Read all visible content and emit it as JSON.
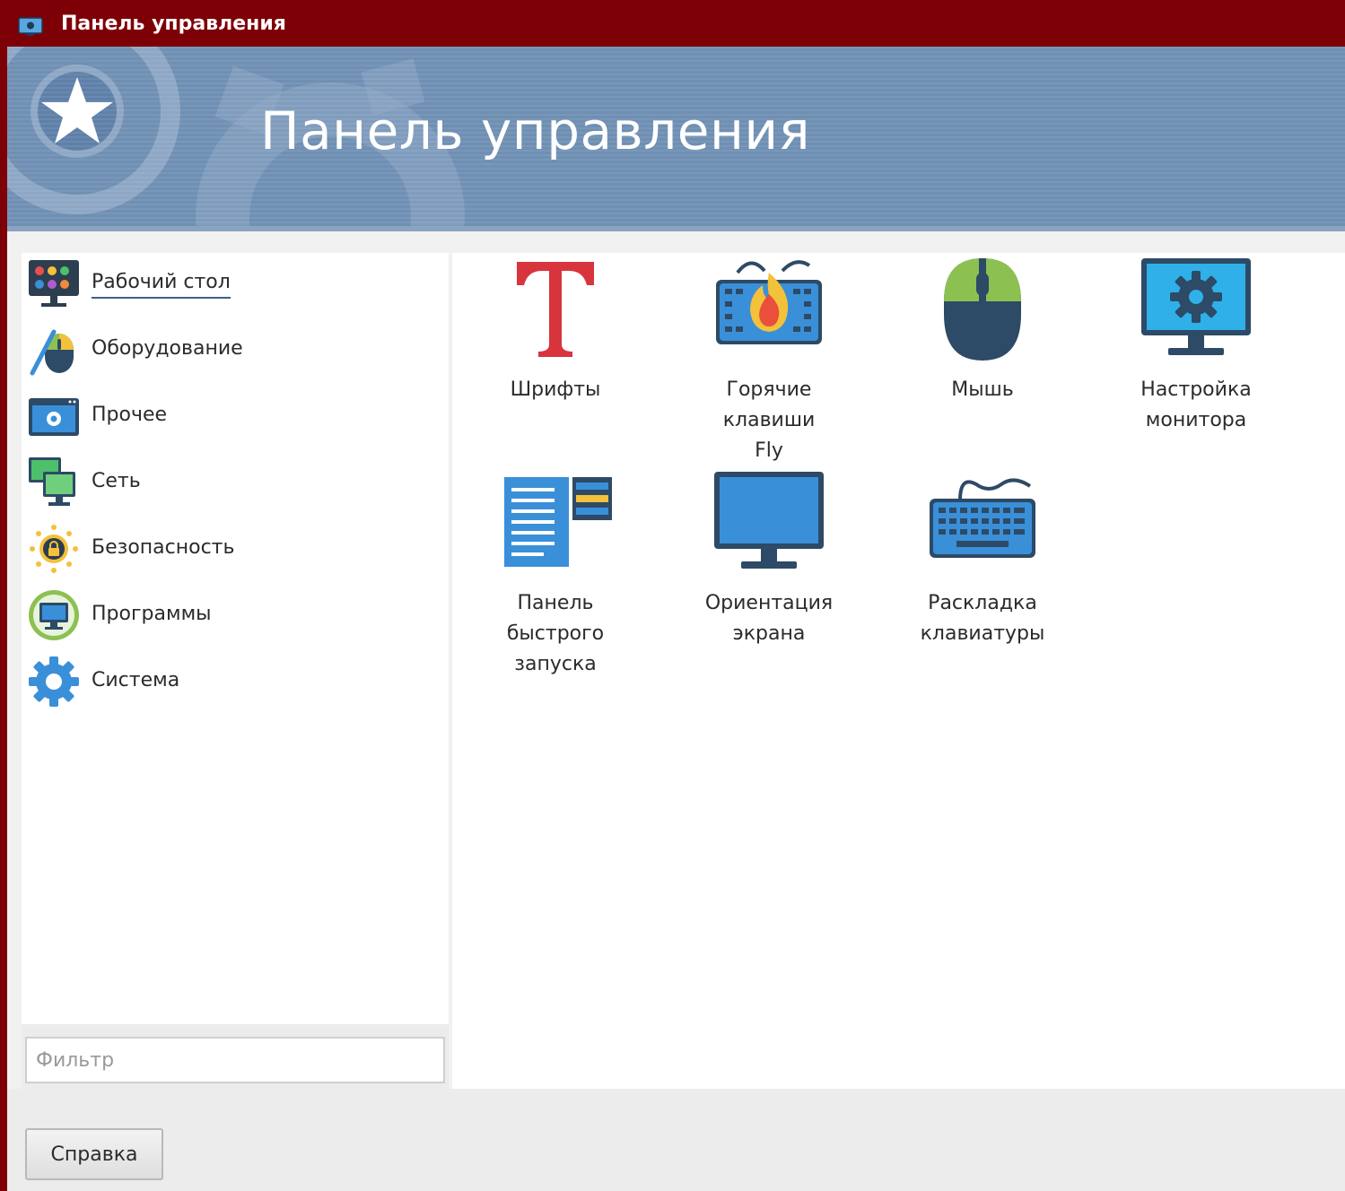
{
  "window": {
    "title": "Панель управления"
  },
  "banner": {
    "title": "Панель управления"
  },
  "sidebar": {
    "items": [
      {
        "label": "Рабочий стол",
        "icon": "desktop-palette-icon",
        "selected": true
      },
      {
        "label": "Оборудование",
        "icon": "hardware-mouse-pen-icon",
        "selected": false
      },
      {
        "label": "Прочее",
        "icon": "other-settings-icon",
        "selected": false
      },
      {
        "label": "Сеть",
        "icon": "network-monitors-icon",
        "selected": false
      },
      {
        "label": "Безопасность",
        "icon": "security-lock-icon",
        "selected": false
      },
      {
        "label": "Программы",
        "icon": "programs-monitor-icon",
        "selected": false
      },
      {
        "label": "Система",
        "icon": "system-gear-icon",
        "selected": false
      }
    ]
  },
  "filter": {
    "placeholder": "Фильтр",
    "value": ""
  },
  "tiles": [
    {
      "label": "Шрифты",
      "icon": "fonts-icon"
    },
    {
      "label": "Горячие\nклавиши\nFly",
      "icon": "hotkeys-icon"
    },
    {
      "label": "Мышь",
      "icon": "mouse-icon"
    },
    {
      "label": "Настройка\nмонитора",
      "icon": "monitor-settings-icon"
    },
    {
      "label": "Панель\nбыстрого\nзапуска",
      "icon": "quick-launch-panel-icon"
    },
    {
      "label": "Ориентация\nэкрана",
      "icon": "screen-orientation-icon"
    },
    {
      "label": "Раскладка\nклавиатуры",
      "icon": "keyboard-layout-icon"
    }
  ],
  "footer": {
    "help_label": "Справка"
  },
  "colors": {
    "titlebar": "#7e0007",
    "banner": "#6f8fb3",
    "accent_blue": "#3a8fd9",
    "dark_navy": "#2d4a66",
    "font_red": "#d8343d"
  }
}
